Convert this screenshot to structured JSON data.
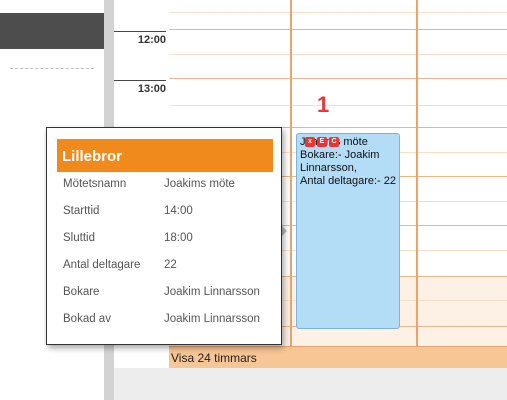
{
  "times": [
    "12:00",
    "13:00"
  ],
  "marker": "1",
  "booking": {
    "text": "Joakims möte\nBokare:- Joakim Linnarsson,\nAntal deltagare:- 22",
    "actions": [
      {
        "label": "x",
        "icon": "delete-icon"
      },
      {
        "label": "E",
        "icon": "edit-icon"
      },
      {
        "label": "C",
        "icon": "copy-icon"
      }
    ]
  },
  "show24": "Visa 24 timmars",
  "popup": {
    "title": "Lillebror",
    "rows": [
      {
        "key": "Mötetsnamn",
        "value": "Joakims möte"
      },
      {
        "key": "Starttid",
        "value": "14:00"
      },
      {
        "key": "Sluttid",
        "value": "18:00"
      },
      {
        "key": "Antal deltagare",
        "value": "22"
      },
      {
        "key": "Bokare",
        "value": "Joakim Linnarsson"
      },
      {
        "key": "Bokad av",
        "value": "Joakim Linnarsson"
      }
    ]
  },
  "colors": {
    "accent": "#f08a1c",
    "booking": "#b3dcf7",
    "marker": "#e53935",
    "grid_line": "#e9b687"
  }
}
